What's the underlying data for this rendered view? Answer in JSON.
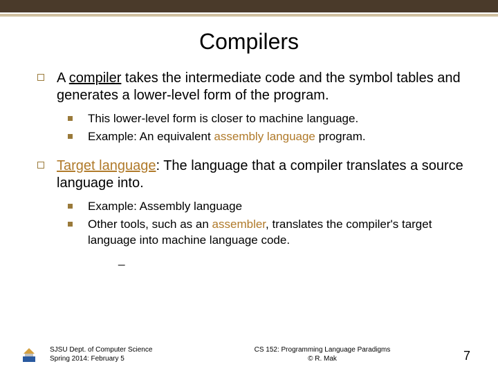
{
  "title": "Compilers",
  "items": [
    {
      "pre": "A ",
      "key": "compiler",
      "post": " takes the intermediate code and the symbol tables and generates a lower-level form of the program.",
      "sub": [
        {
          "pre": "This lower-level form is closer to machine language.",
          "accent": "",
          "post": ""
        },
        {
          "pre": "Example: An equivalent ",
          "accent": "assembly language",
          "post": " program."
        }
      ]
    },
    {
      "pre": "",
      "key": "Target language",
      "post": ": The language that a compiler translates a source language into.",
      "sub": [
        {
          "pre": "Example: Assembly language",
          "accent": "",
          "post": ""
        },
        {
          "pre": "Other tools, such as an ",
          "accent": "assembler",
          "post": ", translates the compiler's target language into machine language code."
        }
      ],
      "dash": "_"
    }
  ],
  "footer": {
    "left1": "SJSU Dept. of Computer Science",
    "left2": "Spring 2014: February 5",
    "center1": "CS 152: Programming Language Paradigms",
    "center2": "© R. Mak",
    "page": "7"
  }
}
